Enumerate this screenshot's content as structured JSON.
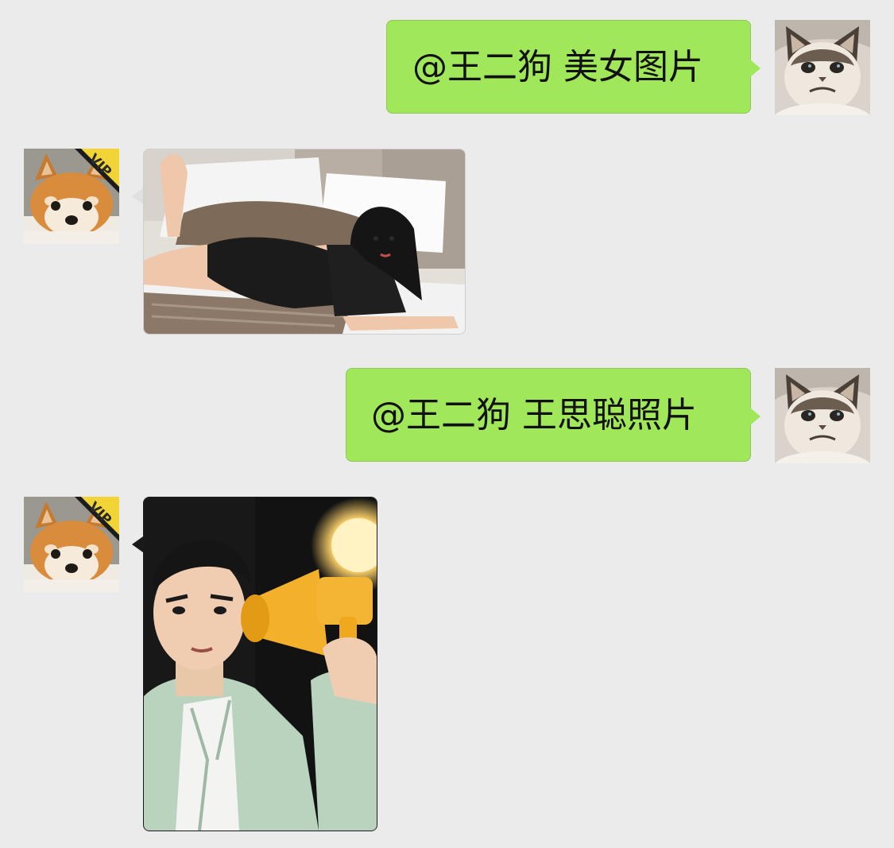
{
  "messages": [
    {
      "direction": "outgoing",
      "sender": "cat-user",
      "type": "text",
      "text": "@王二狗 美女图片"
    },
    {
      "direction": "incoming",
      "sender": "dog-user",
      "type": "image",
      "image_desc": "woman-lying-on-bed-photo"
    },
    {
      "direction": "outgoing",
      "sender": "cat-user",
      "type": "text",
      "text": "@王二狗 王思聪照片"
    },
    {
      "direction": "incoming",
      "sender": "dog-user",
      "type": "image",
      "image_desc": "man-with-megaphone-photo"
    }
  ],
  "badges": {
    "vip": "VIP"
  },
  "colors": {
    "background": "#ebebeb",
    "outgoing_bubble": "#a0e75a",
    "vip_badge": "#f2d437"
  }
}
